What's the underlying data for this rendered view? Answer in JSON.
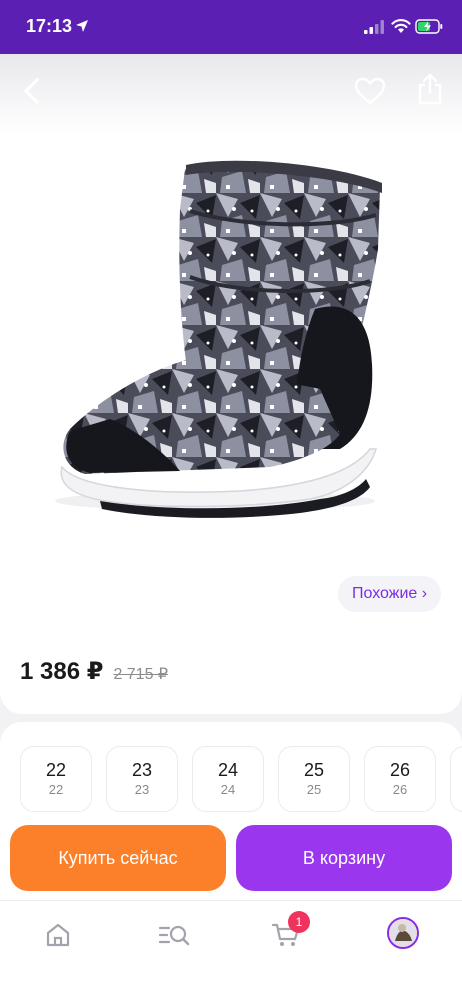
{
  "status_bar": {
    "time": "17:13"
  },
  "product": {
    "similar_label": "Похожие ›",
    "price": "1 386 ₽",
    "old_price": "2 715 ₽"
  },
  "sizes": [
    {
      "main": "22",
      "sub": "22"
    },
    {
      "main": "23",
      "sub": "23"
    },
    {
      "main": "24",
      "sub": "24"
    },
    {
      "main": "25",
      "sub": "25"
    },
    {
      "main": "26",
      "sub": "26"
    }
  ],
  "actions": {
    "buy_now_label": "Купить сейчас",
    "add_to_cart_label": "В корзину"
  },
  "bottom_nav": {
    "cart_badge": "1",
    "items": [
      "home-icon",
      "catalog-search-icon",
      "cart-icon",
      "profile-avatar"
    ]
  },
  "colors": {
    "brand_purple": "#5b1fb3",
    "buy_orange": "#fc7f2a",
    "cart_purple": "#9a36ee",
    "accent_text": "#7b2fe0",
    "badge_red": "#f0335e"
  }
}
